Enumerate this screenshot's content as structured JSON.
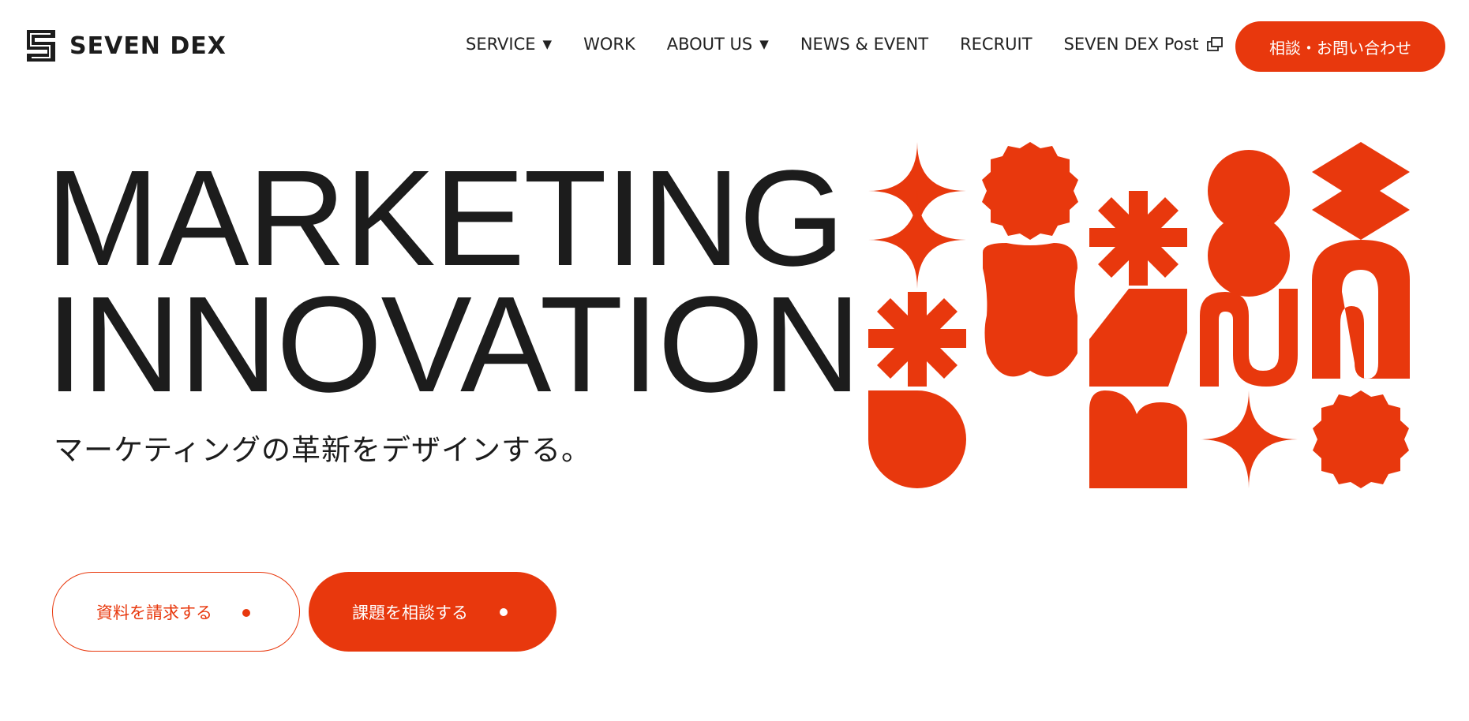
{
  "brand": {
    "name": "SEVEN DEX",
    "accent_color": "#e8380d",
    "text_color": "#1c1c1c"
  },
  "nav": {
    "items": [
      {
        "label": "SERVICE",
        "has_dropdown": true
      },
      {
        "label": "WORK",
        "has_dropdown": false
      },
      {
        "label": "ABOUT US",
        "has_dropdown": true
      },
      {
        "label": "NEWS & EVENT",
        "has_dropdown": false
      },
      {
        "label": "RECRUIT",
        "has_dropdown": false
      },
      {
        "label": "SEVEN DEX Post",
        "external": true
      }
    ],
    "dropdown_glyph": "▼",
    "cta_label": "相談・お問い合わせ"
  },
  "hero": {
    "title_line1": "MARKETING",
    "title_line2": "INNOVATION",
    "subtitle": "マーケティングの革新をデザインする。",
    "graphic": "orange-geometric-shapes-pattern"
  },
  "buttons": {
    "request_docs": "資料を請求する",
    "consult": "課題を相談する"
  },
  "icons": {
    "logo": "seven-dex-logo-icon",
    "external_link": "external-link-icon",
    "dropdown": "chevron-down-icon"
  }
}
